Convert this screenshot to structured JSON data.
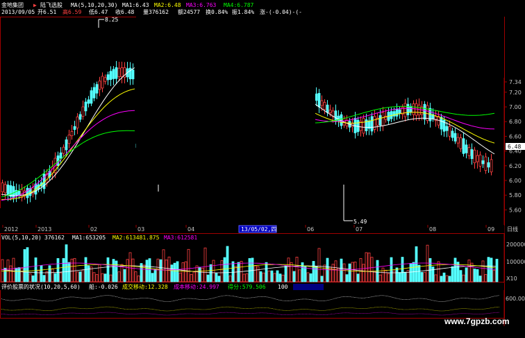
{
  "header": {
    "stock_name": "金地集团",
    "arrow": "▶",
    "indicator_name": "陆飞选股",
    "ma_params": "MA(5,10,20,30)",
    "ma1": "MA1:6.43",
    "ma2": "MA2:6.48",
    "ma3": "MA3:6.763",
    "ma4": "MA4:6.787"
  },
  "quote": {
    "date": "2013/09/05",
    "open": "开6.51",
    "high": "高6.59",
    "low": "低6.47",
    "close": "收6.48",
    "volume": "量376162",
    "amount": "额24577",
    "turnover": "换0.84%",
    "amplitude": "振1.84%",
    "change": "涨-(-0.04)-(-"
  },
  "annotations": {
    "high_marker": "8.25",
    "low_marker": "5.49",
    "date_box": "13/05/02,四"
  },
  "vol_panel": {
    "title": "VOL(5,10,20)",
    "value": "376162",
    "ma1": "MA1:653205",
    "ma2": "MA2:613481.875",
    "ma3": "MA3:612581"
  },
  "indicator_panel": {
    "title": "评价股票的状况(10,20,5,60)",
    "v1": "船:-0.026",
    "v2": "成交移动:12.328",
    "v3": "成本移动:24.997",
    "v4": "得分:579.506",
    "v5": "100"
  },
  "right_axis": {
    "current_price": "6.48",
    "daily_label": "日线"
  },
  "watermark": "www.7gpzb.com",
  "chart_data": {
    "type": "candlestick",
    "price_axis": {
      "ticks": [
        "7.34",
        "7.20",
        "7.00",
        "6.80",
        "6.60",
        "6.40",
        "6.20",
        "6.00",
        "5.80",
        "5.60"
      ],
      "ylim": [
        5.5,
        7.4
      ]
    },
    "x_ticks": [
      "2012",
      "2013",
      "02",
      "03",
      "04",
      "06",
      "07",
      "08",
      "09"
    ],
    "volume_axis": {
      "ticks": [
        "200000",
        "100000",
        "X10"
      ],
      "ylim": [
        0,
        220000
      ]
    },
    "indicator_axis": {
      "ticks": [
        "600.00"
      ]
    },
    "colors": {
      "up": "#ff4040",
      "down": "#54ffff",
      "ma1": "#ffffff",
      "ma2": "#ffff00",
      "ma3": "#ff00ff",
      "ma4": "#00ff00"
    },
    "series_note": "Daily candles with 4 moving averages; central region of image is blacked out."
  }
}
